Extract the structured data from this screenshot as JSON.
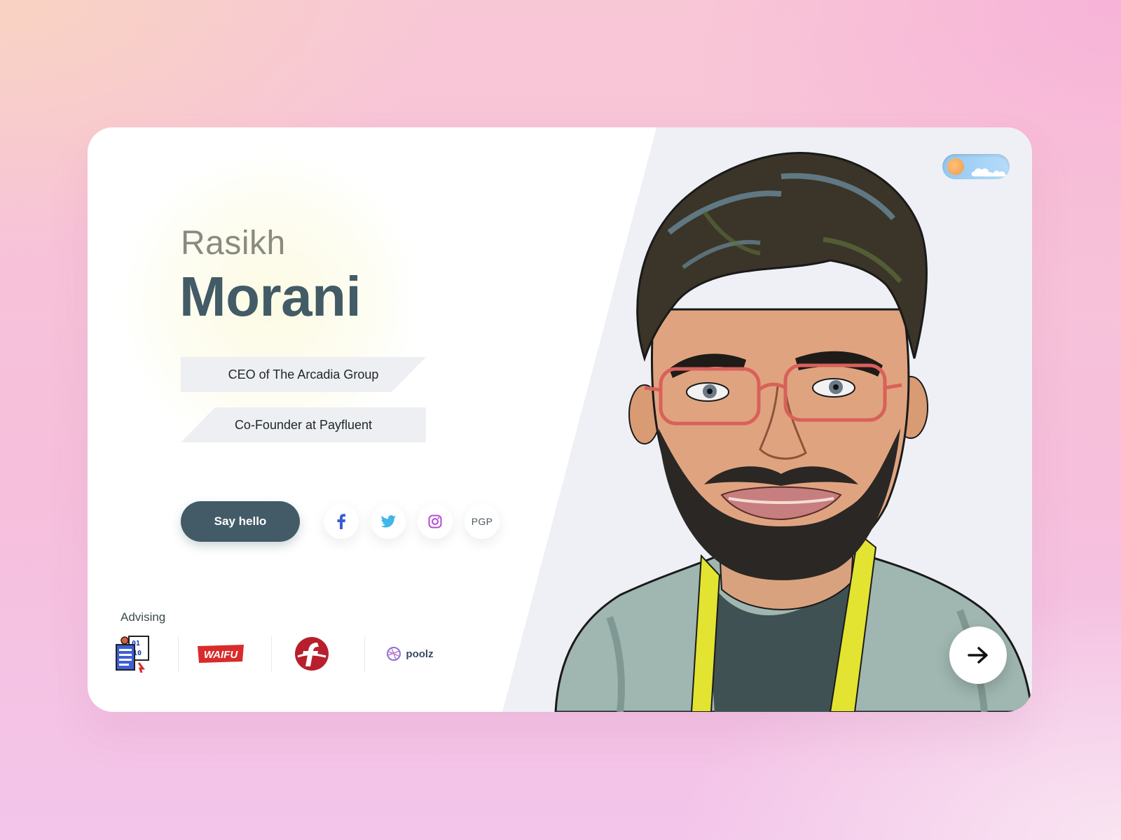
{
  "profile": {
    "first_name": "Rasikh",
    "last_name": "Morani",
    "roles": [
      "CEO of The Arcadia Group",
      "Co-Founder at Payfluent"
    ]
  },
  "actions": {
    "say_hello_label": "Say hello",
    "social": [
      {
        "name": "facebook",
        "icon": "facebook-icon",
        "color": "#3b5bdb"
      },
      {
        "name": "twitter",
        "icon": "twitter-icon",
        "color": "#3fb6e8"
      },
      {
        "name": "instagram",
        "icon": "instagram-icon",
        "color": "#b44bd0"
      },
      {
        "name": "pgp",
        "label": "PGP"
      }
    ]
  },
  "advising": {
    "label": "Advising",
    "logos": [
      {
        "name": "binary-doc-logo"
      },
      {
        "name": "waifu-logo",
        "text": "WAIFU",
        "color": "#d92b2b"
      },
      {
        "name": "f-logo",
        "color": "#b81f2d"
      },
      {
        "name": "poolz-logo",
        "text": "poolz"
      }
    ]
  },
  "theme_toggle": {
    "mode": "light",
    "icon": "sun-icon"
  },
  "next_button": {
    "icon": "arrow-right-icon"
  },
  "colors": {
    "primary": "#425b66",
    "panel": "#eef0f5",
    "accent_toggle": "#93c8f2"
  }
}
